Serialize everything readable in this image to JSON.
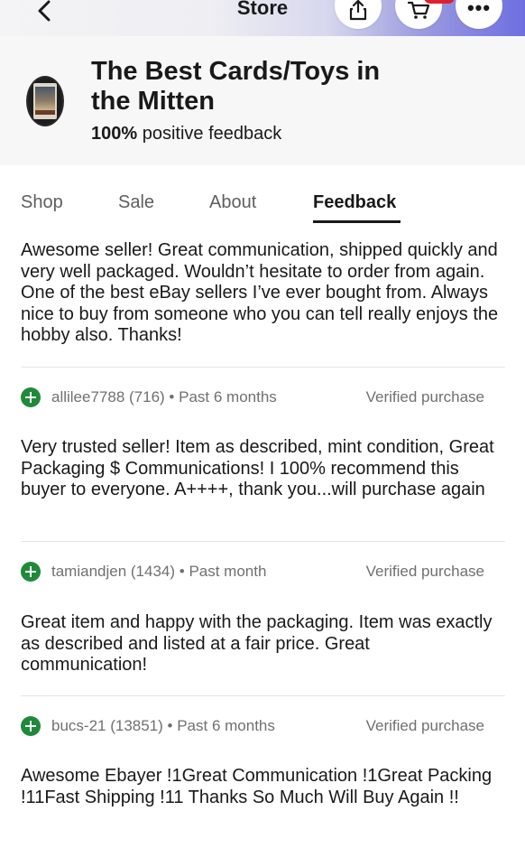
{
  "topbar": {
    "title": "Store",
    "back_icon": "chevron-left-icon",
    "share_icon": "share-icon",
    "cart_icon": "cart-icon",
    "more_label": "•••",
    "gradient_accent": "#6e6ee0",
    "cart_badge_color": "#e0202c"
  },
  "store": {
    "name": "The Best Cards/Toys in the Mitten",
    "feedback_percent": "100%",
    "feedback_suffix": " positive feedback"
  },
  "tabs": [
    {
      "label": "Shop",
      "active": false
    },
    {
      "label": "Sale",
      "active": false
    },
    {
      "label": "About",
      "active": false
    },
    {
      "label": "Feedback",
      "active": true
    }
  ],
  "feedback": [
    {
      "comment": "Awesome seller! Great communication, shipped quickly and very well packaged. Wouldn’t hesitate to order from again. One of the best eBay sellers I’ve ever bought from. Always nice to buy from someone who you can tell really enjoys the hobby also. Thanks!",
      "user": "allilee7788 (716)",
      "when": "Past 6 months",
      "verified": "Verified purchase"
    },
    {
      "comment": "Very trusted seller! Item as described, mint condition, Great Packaging $ Communications! I 100% recommend this buyer to everyone. A++++, thank you...will purchase again",
      "user": "tamiandjen (1434)",
      "when": "Past month",
      "verified": "Verified purchase"
    },
    {
      "comment": "Great item and happy with the packaging. Item was exactly as described and listed at a fair price. Great communication!",
      "user": "bucs-21 (13851)",
      "when": "Past 6 months",
      "verified": "Verified purchase"
    },
    {
      "comment": "Awesome Ebayer !1Great Communication !1Great Packing !11Fast Shipping !11 Thanks So Much Will Buy Again !!"
    }
  ],
  "colors": {
    "positive_icon": "#1f8a3a",
    "meta_text": "#707070",
    "header_bg": "#f7f7f7"
  }
}
